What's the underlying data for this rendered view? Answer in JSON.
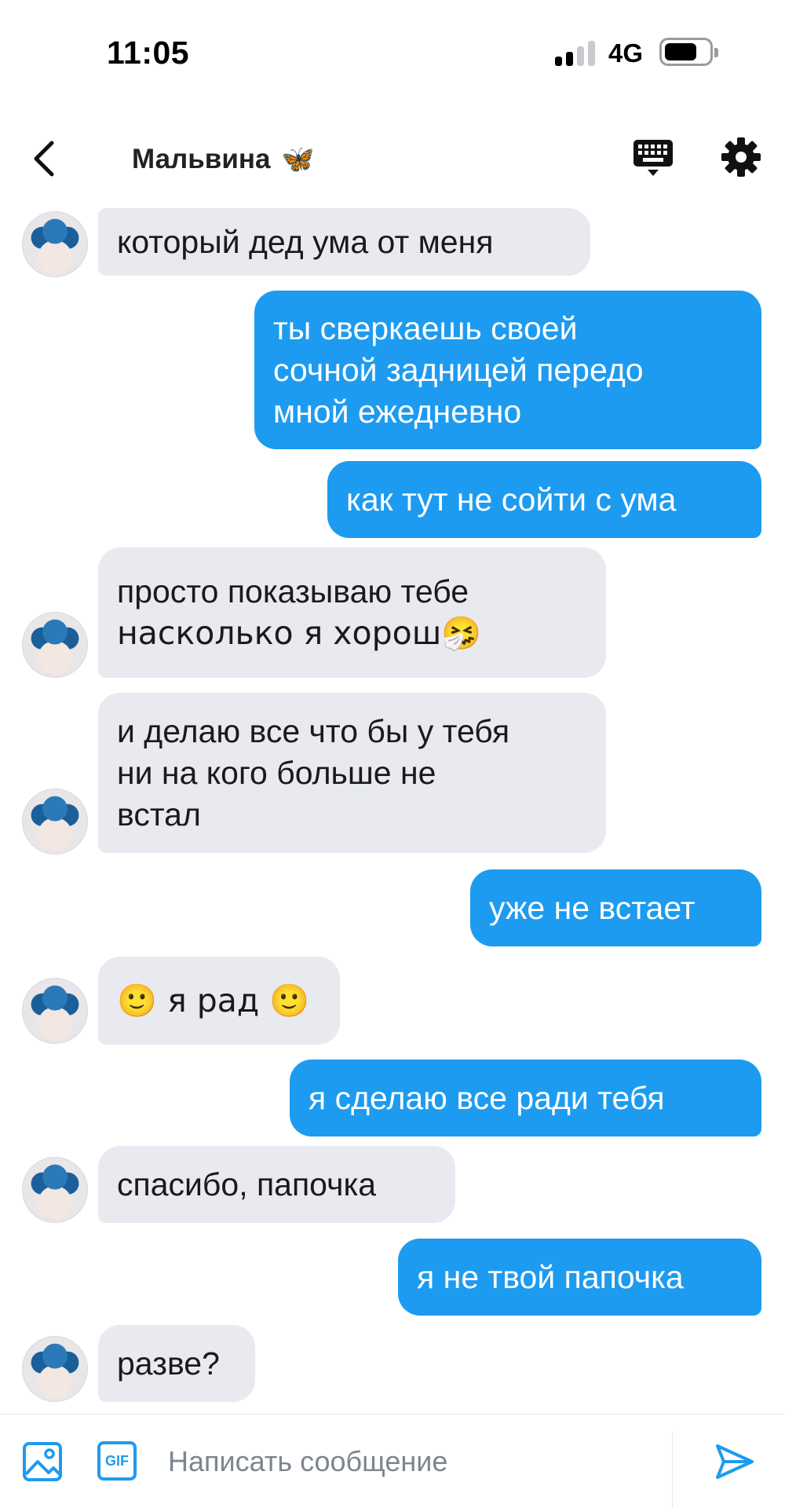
{
  "status_bar": {
    "time": "11:05",
    "network": "4G",
    "signal_bars": 2,
    "signal_total": 4,
    "battery_level": 0.7
  },
  "header": {
    "title": "Мальвина",
    "title_emoji": "🦋",
    "back_icon": "chevron-left-icon",
    "keyboard_icon": "keyboard-icon",
    "settings_icon": "gear-icon"
  },
  "colors": {
    "outgoing_bubble": "#1d9bf0",
    "incoming_bubble": "#e8eaf0",
    "accent": "#1d9bf0"
  },
  "messages": [
    {
      "dir": "in",
      "text": "который дед ума от меня",
      "avatar": true
    },
    {
      "dir": "out",
      "lines": [
        "ты сверкаешь своей",
        "сочной задницей передо",
        "мной ежедневно"
      ]
    },
    {
      "dir": "out",
      "text": "как тут не сойти с ума"
    },
    {
      "dir": "in",
      "lines": [
        "просто показываю тебе",
        "насколько я хорош🤧"
      ],
      "avatar": true
    },
    {
      "dir": "in",
      "lines": [
        "и делаю все что бы у тебя",
        "ни на кого больше не",
        "встал"
      ],
      "avatar": true
    },
    {
      "dir": "out",
      "text": "уже не встает"
    },
    {
      "dir": "in",
      "text": "🙂 я рад 🙂",
      "avatar": true
    },
    {
      "dir": "out",
      "text": "я сделаю все ради тебя"
    },
    {
      "dir": "in",
      "text": "спасибо, папочка",
      "avatar": true
    },
    {
      "dir": "out",
      "text": "я не твой папочка"
    },
    {
      "dir": "in",
      "text": "разве?",
      "avatar": true
    }
  ],
  "composer": {
    "placeholder": "Написать сообщение",
    "gif_label": "GIF",
    "image_icon": "image-icon",
    "send_icon": "send-icon"
  }
}
